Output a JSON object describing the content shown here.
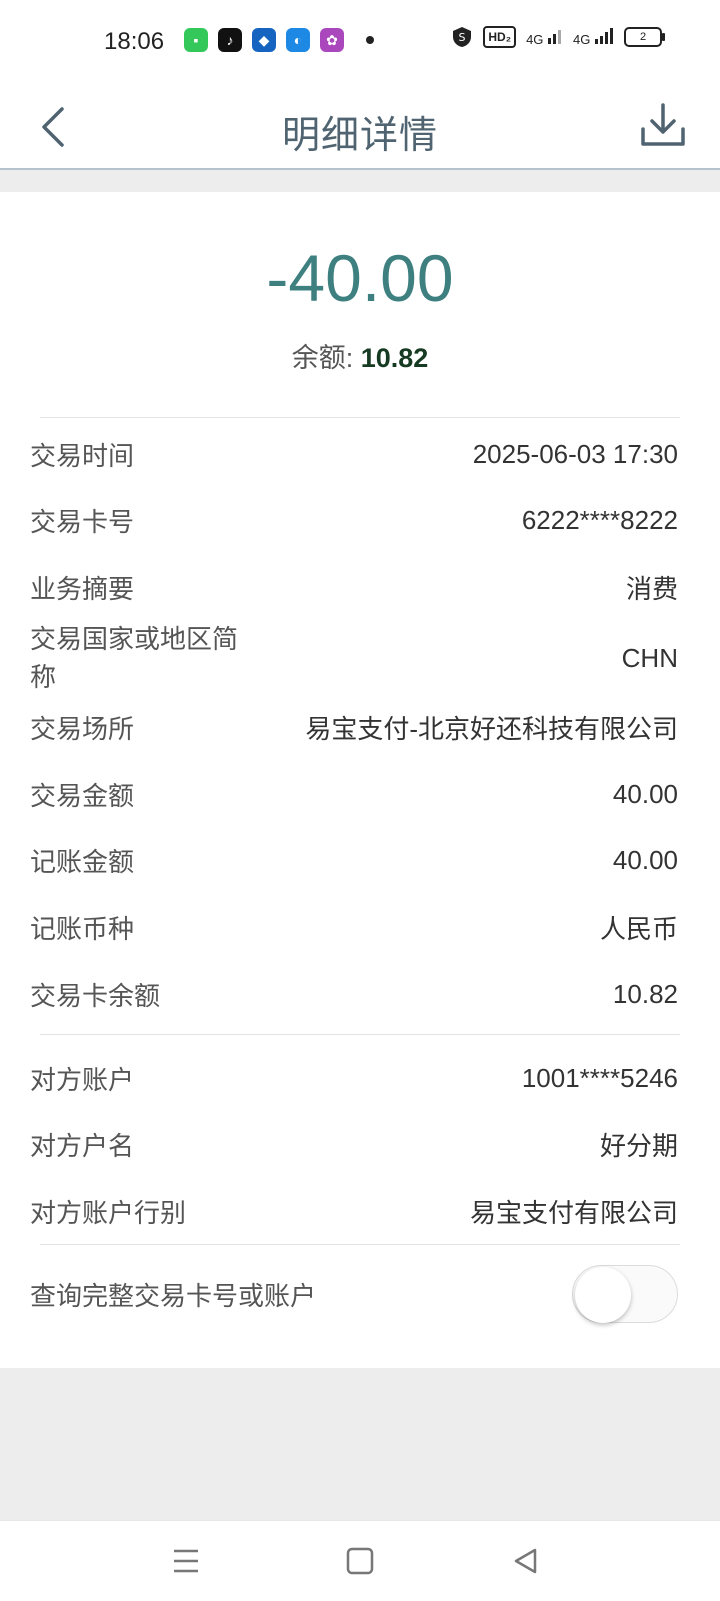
{
  "status_bar": {
    "time": "18:06",
    "badge_hd": "HD₂",
    "net_1": "4G",
    "net_2": "4G",
    "battery": "2"
  },
  "header": {
    "title": "明细详情",
    "back_icon": "chevron-left-icon",
    "download_icon": "download-icon"
  },
  "summary": {
    "amount": "-40.00",
    "balance_label": "余额: ",
    "balance_value": "10.82"
  },
  "details": [
    {
      "label": "交易时间",
      "value": "2025-06-03 17:30"
    },
    {
      "label": "交易卡号",
      "value": "6222****8222"
    },
    {
      "label": "业务摘要",
      "value": "消费"
    },
    {
      "label": "交易国家或地区简称",
      "value": "CHN"
    },
    {
      "label": "交易场所",
      "value": "易宝支付-北京好还科技有限公司"
    },
    {
      "label": "交易金额",
      "value": "40.00"
    },
    {
      "label": "记账金额",
      "value": "40.00"
    },
    {
      "label": "记账币种",
      "value": "人民币"
    },
    {
      "label": "交易卡余额",
      "value": "10.82"
    }
  ],
  "counterparty": [
    {
      "label": "对方账户",
      "value": "1001****5246"
    },
    {
      "label": "对方户名",
      "value": "好分期"
    },
    {
      "label": "对方账户行别",
      "value": "易宝支付有限公司"
    }
  ],
  "toggle": {
    "label": "查询完整交易卡号或账户",
    "enabled": false
  },
  "colors": {
    "amount": "#3e7f80",
    "title": "#4f6470",
    "balance_value": "#173b22"
  }
}
